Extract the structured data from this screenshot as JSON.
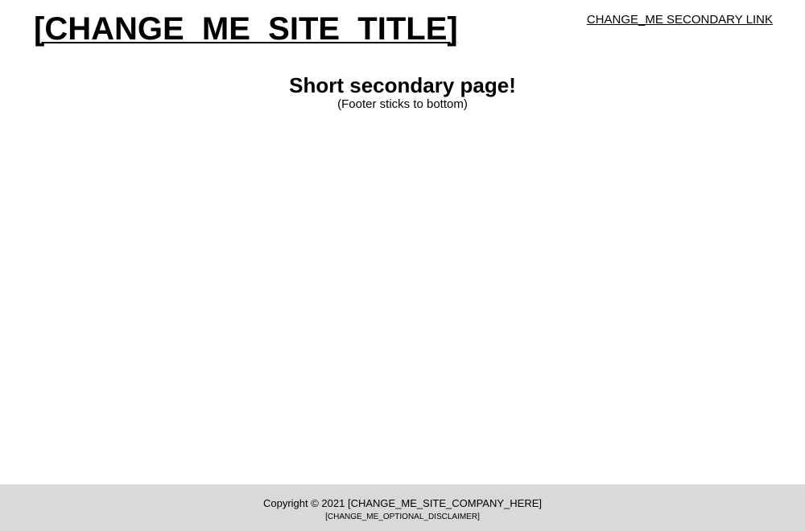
{
  "header": {
    "site_title": "[CHANGE_ME_SITE_TITLE]",
    "secondary_link": "CHANGE_ME SECONDARY LINK"
  },
  "main": {
    "heading": "Short secondary page!",
    "subtext": "(Footer sticks to bottom)"
  },
  "footer": {
    "copyright": "Copyright © 2021 [CHANGE_ME_SITE_COMPANY_HERE]",
    "disclaimer": "[CHANGE_ME_OPTIONAL_DISCLAIMER]",
    "background_color": "#d9d9d9"
  }
}
